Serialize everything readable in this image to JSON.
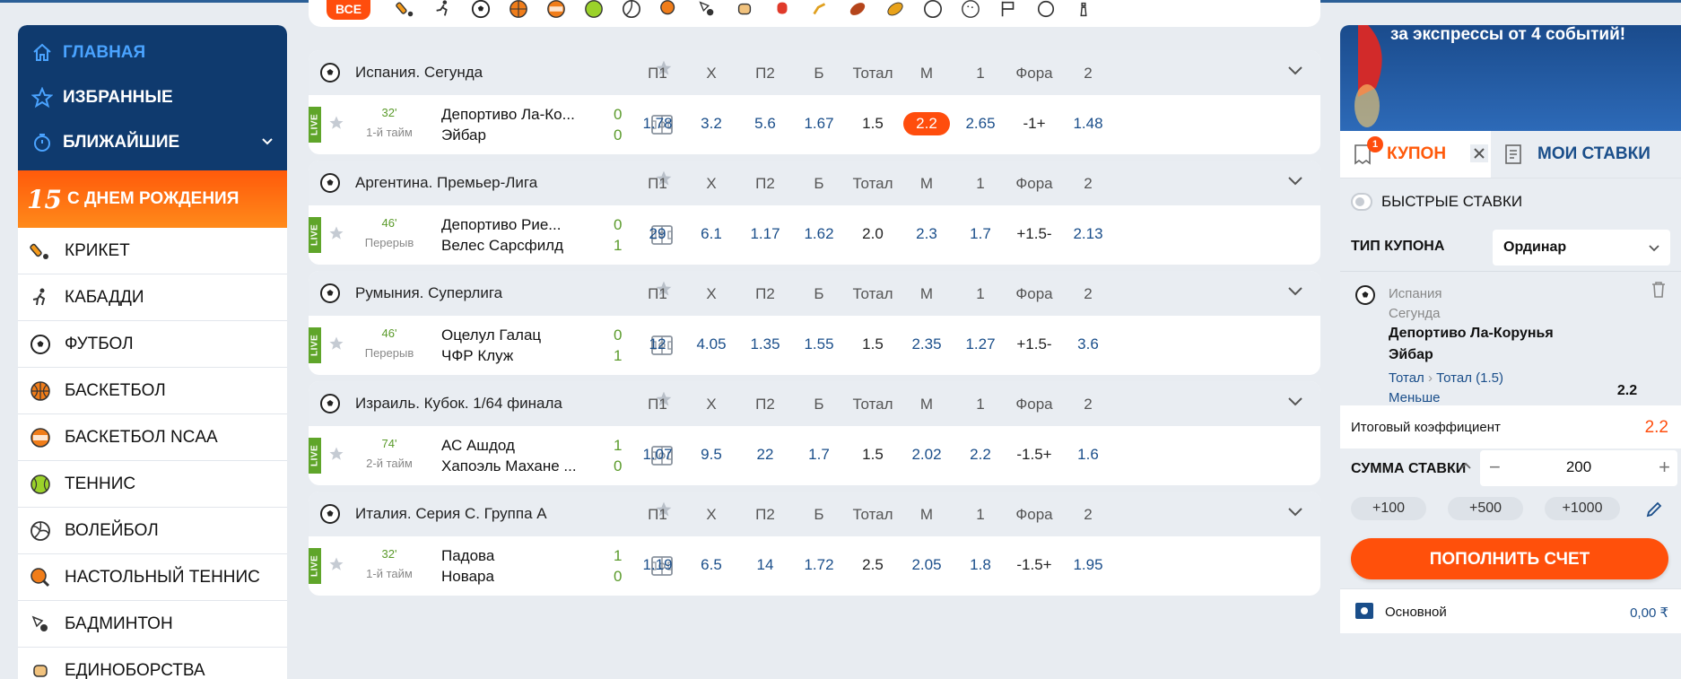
{
  "sidebar": {
    "nav": [
      {
        "label": "ГЛАВНАЯ",
        "icon": "home-icon"
      },
      {
        "label": "ИЗБРАННЫЕ",
        "icon": "star-icon"
      },
      {
        "label": "БЛИЖАЙШИЕ",
        "icon": "timer-icon"
      }
    ],
    "promo": {
      "badge": "15",
      "label": "С ДНЕМ РОЖДЕНИЯ"
    },
    "sports": [
      {
        "label": "КРИКЕТ",
        "icon": "cricket-icon"
      },
      {
        "label": "КАБАДДИ",
        "icon": "kabaddi-icon"
      },
      {
        "label": "ФУТБОЛ",
        "icon": "football-icon"
      },
      {
        "label": "БАСКЕТБОЛ",
        "icon": "basketball-icon"
      },
      {
        "label": "БАСКЕТБОЛ NCAA",
        "icon": "basketball-ncaa-icon"
      },
      {
        "label": "ТЕННИС",
        "icon": "tennis-icon"
      },
      {
        "label": "ВОЛЕЙБОЛ",
        "icon": "volleyball-icon"
      },
      {
        "label": "НАСТОЛЬНЫЙ ТЕННИС",
        "icon": "table-tennis-icon"
      },
      {
        "label": "БАДМИНТОН",
        "icon": "badminton-icon"
      },
      {
        "label": "ЕДИНОБОРСТВА",
        "icon": "martial-arts-icon"
      }
    ]
  },
  "sportbar": {
    "all_label": "ВСЕ"
  },
  "columns": [
    "П1",
    "X",
    "П2",
    "Б",
    "Тотал",
    "М",
    "1",
    "Фора",
    "2"
  ],
  "live_label": "LIVE",
  "matches": [
    {
      "league": "Испания. Сегунда",
      "minute": "32'",
      "period": "1-й тайм",
      "team1": "Депортиво Ла-Ко...",
      "team2": "Эйбар",
      "score1": "0",
      "score2": "0",
      "odds": [
        "1.78",
        "3.2",
        "5.6",
        "1.67",
        "1.5",
        "2.2",
        "2.65",
        "-1+",
        "1.48"
      ]
    },
    {
      "league": "Аргентина. Премьер-Лига",
      "minute": "46'",
      "period": "Перерыв",
      "team1": "Депортиво Рие...",
      "team2": "Велес Сарсфилд",
      "score1": "0",
      "score2": "1",
      "odds": [
        "29",
        "6.1",
        "1.17",
        "1.62",
        "2.0",
        "2.3",
        "1.7",
        "+1.5-",
        "2.13"
      ]
    },
    {
      "league": "Румыния. Суперлига",
      "minute": "46'",
      "period": "Перерыв",
      "team1": "Оцелул Галац",
      "team2": "ЧФР Клуж",
      "score1": "0",
      "score2": "1",
      "odds": [
        "12",
        "4.05",
        "1.35",
        "1.55",
        "1.5",
        "2.35",
        "1.27",
        "+1.5-",
        "3.6"
      ]
    },
    {
      "league": "Израиль. Кубок. 1/64 финала",
      "minute": "74'",
      "period": "2-й тайм",
      "team1": "АС Ашдод",
      "team2": "Хапоэль Махане ...",
      "score1": "1",
      "score2": "0",
      "odds": [
        "1.07",
        "9.5",
        "22",
        "1.7",
        "1.5",
        "2.02",
        "2.2",
        "-1.5+",
        "1.6"
      ]
    },
    {
      "league": "Италия. Серия С. Группа А",
      "minute": "32'",
      "period": "1-й тайм",
      "team1": "Падова",
      "team2": "Новара",
      "score1": "1",
      "score2": "0",
      "odds": [
        "1.19",
        "6.5",
        "14",
        "1.72",
        "2.5",
        "2.05",
        "1.8",
        "-1.5+",
        "1.95"
      ]
    }
  ],
  "banner": {
    "text": "за экспрессы от 4 событий!"
  },
  "coupon": {
    "tab_coupon": "КУПОН",
    "tab_badge": "1",
    "tab_bets": "МОИ СТАВКИ",
    "quick_bets": "БЫСТРЫЕ СТАВКИ",
    "type_label": "ТИП КУПОНА",
    "type_value": "Ординар",
    "bet": {
      "country": "Испания",
      "league": "Сегунда",
      "team1": "Депортиво Ла-Корунья",
      "team2": "Эйбар",
      "market": "Тотал",
      "market_sub": "Тотал (1.5)",
      "outcome": "Меньше",
      "odd": "2.2"
    },
    "total_label": "Итоговый коэффициент",
    "total_value": "2.2",
    "sum_label": "СУММА СТАВКИ",
    "sum_value": "200",
    "quick_add": [
      "+100",
      "+500",
      "+1000"
    ],
    "deposit_label": "ПОПОЛНИТЬ СЧЕТ",
    "account_label": "Основной",
    "account_value": "0,00 ₹"
  },
  "colors": {
    "accent": "#ff4d0d",
    "brand": "#0f3a6e",
    "link": "#1a4e8a",
    "live": "#5fa52a"
  }
}
